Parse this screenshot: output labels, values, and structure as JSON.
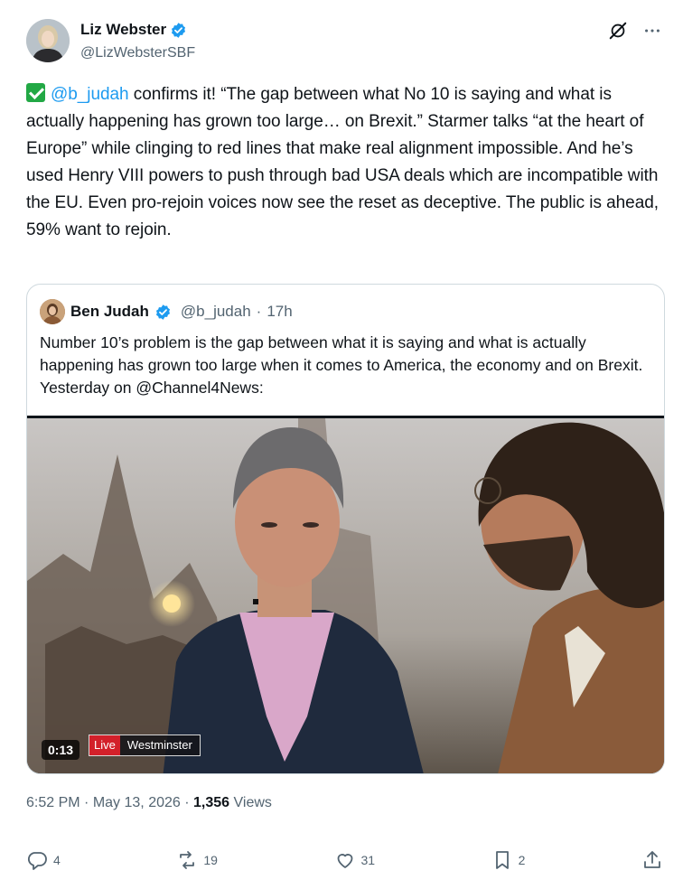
{
  "author": {
    "display_name": "Liz Webster",
    "handle": "@LizWebsterSBF"
  },
  "tweet": {
    "mention": "@b_judah",
    "text": " confirms it! “The gap between what No 10 is saying and what is actually happening has grown too large… on Brexit.” Starmer talks “at the heart of Europe” while clinging to red lines that make real alignment impossible. And he’s used Henry VIII powers to push through bad USA deals which are incompatible with the EU. Even pro-rejoin voices now see the reset as deceptive. The public is ahead, 59% want to rejoin."
  },
  "quote": {
    "display_name": "Ben Judah",
    "handle": "@b_judah",
    "separator": "·",
    "age": "17h",
    "text": "Number 10’s problem is the gap between what it is saying and what is actually happening has grown too large when it comes to America, the economy and on Brexit. Yesterday on @Channel4News:",
    "video": {
      "duration": "0:13",
      "live_label": "Live",
      "location_label": "Westminster"
    }
  },
  "meta": {
    "time": "6:52 PM",
    "dot": "·",
    "date": "May 13, 2026",
    "views_count": "1,356",
    "views_label": "Views"
  },
  "actions": {
    "replies": "4",
    "reposts": "19",
    "likes": "31",
    "bookmarks": "2"
  },
  "colors": {
    "accent": "#1d9bf0",
    "text": "#0f1419",
    "muted": "#536471",
    "border": "#cfd9de",
    "live_red": "#d3202a",
    "check_green": "#22a845"
  },
  "icons": {
    "verified": "verified-badge-icon",
    "grok": "grok-icon",
    "more": "more-dots-icon",
    "reply": "reply-icon",
    "repost": "repost-icon",
    "like": "heart-icon",
    "bookmark": "bookmark-icon",
    "share": "share-icon"
  }
}
